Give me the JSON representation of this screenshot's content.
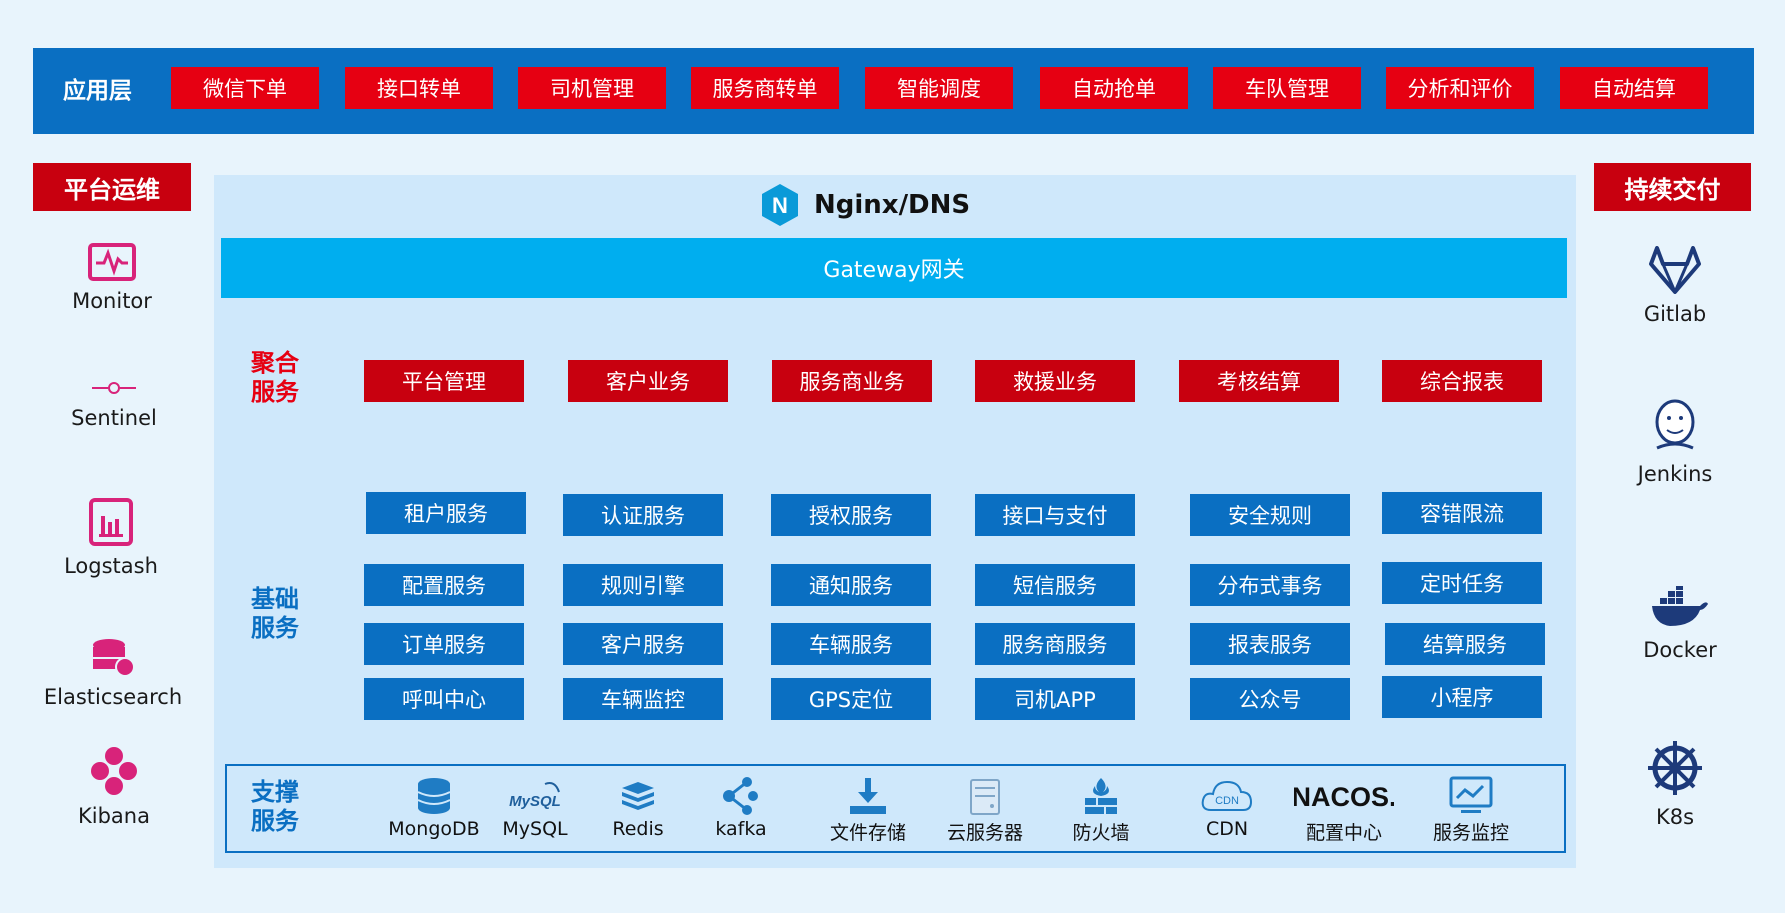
{
  "app_layer": {
    "title": "应用层",
    "items": [
      "微信下单",
      "接口转单",
      "司机管理",
      "服务商转单",
      "智能调度",
      "自动抢单",
      "车队管理",
      "分析和评价",
      "自动结算"
    ]
  },
  "ops": {
    "title": "平台运维",
    "tools": [
      {
        "label": "Monitor",
        "icon": "monitor-icon"
      },
      {
        "label": "Sentinel",
        "icon": "sentinel-icon"
      },
      {
        "label": "Logstash",
        "icon": "logstash-icon"
      },
      {
        "label": "Elasticsearch",
        "icon": "elasticsearch-icon"
      },
      {
        "label": "Kibana",
        "icon": "kibana-icon"
      }
    ]
  },
  "delivery": {
    "title": "持续交付",
    "tools": [
      {
        "label": "Gitlab",
        "icon": "gitlab-icon"
      },
      {
        "label": "Jenkins",
        "icon": "jenkins-icon"
      },
      {
        "label": "Docker",
        "icon": "docker-icon"
      },
      {
        "label": "K8s",
        "icon": "k8s-icon"
      }
    ]
  },
  "nginx": {
    "label": "Nginx/DNS",
    "icon_letter": "N"
  },
  "gateway": {
    "label": "Gateway网关"
  },
  "aggregate": {
    "label_line1": "聚合",
    "label_line2": "服务",
    "items": [
      "平台管理",
      "客户业务",
      "服务商业务",
      "救援业务",
      "考核结算",
      "综合报表"
    ]
  },
  "base": {
    "label_line1": "基础",
    "label_line2": "服务",
    "rows": [
      [
        "租户服务",
        "认证服务",
        "授权服务",
        "接口与支付",
        "安全规则",
        "容错限流"
      ],
      [
        "配置服务",
        "规则引擎",
        "通知服务",
        "短信服务",
        "分布式事务",
        "定时任务"
      ],
      [
        "订单服务",
        "客户服务",
        "车辆服务",
        "服务商服务",
        "报表服务",
        "结算服务"
      ],
      [
        "呼叫中心",
        "车辆监控",
        "GPS定位",
        "司机APP",
        "公众号",
        "小程序"
      ]
    ]
  },
  "support": {
    "label_line1": "支撑",
    "label_line2": "服务",
    "items": [
      {
        "label": "MongoDB",
        "icon": "mongodb-icon"
      },
      {
        "label": "MySQL",
        "icon": "mysql-icon",
        "icon_text": "MySQL"
      },
      {
        "label": "Redis",
        "icon": "redis-icon"
      },
      {
        "label": "kafka",
        "icon": "kafka-icon"
      },
      {
        "label": "文件存储",
        "icon": "file-storage-icon"
      },
      {
        "label": "云服务器",
        "icon": "cloud-server-icon"
      },
      {
        "label": "防火墙",
        "icon": "firewall-icon"
      },
      {
        "label": "CDN",
        "icon": "cdn-icon",
        "icon_text": "CDN"
      },
      {
        "label": "配置中心",
        "icon": "nacos-logo",
        "icon_text": "NACOS."
      },
      {
        "label": "服务监控",
        "icon": "service-monitor-icon"
      }
    ]
  },
  "colors": {
    "red": "#e60012",
    "dark_red": "#c8000f",
    "blue": "#0a6fc2",
    "cyan": "#00aeef",
    "panel": "#cfe8fb",
    "background": "#e8f4fc"
  }
}
